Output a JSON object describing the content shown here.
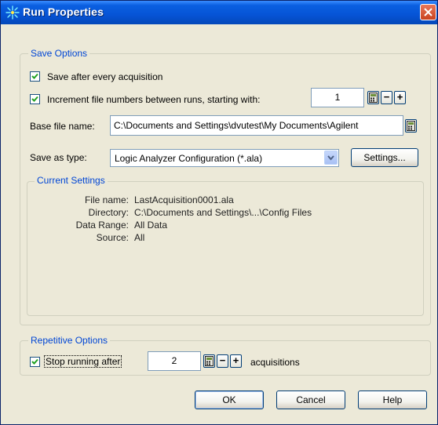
{
  "window": {
    "title": "Run Properties",
    "icon": "sparkle-icon",
    "close_icon": "close-icon"
  },
  "save_options": {
    "legend": "Save Options",
    "save_after": {
      "label": "Save after every acquisition",
      "checked": true
    },
    "increment": {
      "label": "Increment file numbers between runs, starting with:",
      "checked": true,
      "value": "1"
    },
    "base_file_name": {
      "label": "Base file name:",
      "value": "C:\\Documents and Settings\\dvutest\\My Documents\\Agilent"
    },
    "save_as_type": {
      "label": "Save as type:",
      "value": "Logic Analyzer Configuration (*.ala)"
    },
    "settings_button": "Settings..."
  },
  "current_settings": {
    "legend": "Current Settings",
    "rows": [
      {
        "key": "File name:",
        "value": "LastAcquisition0001.ala"
      },
      {
        "key": "Directory:",
        "value": "C:\\Documents and Settings\\...\\Config Files"
      },
      {
        "key": "Data Range:",
        "value": "All Data"
      },
      {
        "key": "Source:",
        "value": "All"
      }
    ]
  },
  "repetitive_options": {
    "legend": "Repetitive Options",
    "stop_running": {
      "label": "Stop running after",
      "checked": true,
      "value": "2",
      "suffix": "acquisitions"
    }
  },
  "spin": {
    "minus": "−",
    "plus": "+"
  },
  "buttons": {
    "ok": "OK",
    "cancel": "Cancel",
    "help": "Help"
  },
  "colors": {
    "accent": "#0046D5",
    "titlebar": "#0654D6",
    "dialog_bg": "#ECE9D8"
  }
}
